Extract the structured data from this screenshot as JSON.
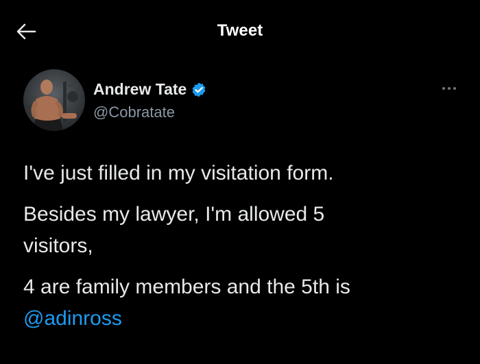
{
  "header": {
    "title": "Tweet",
    "back_icon": "arrow-left-icon"
  },
  "author": {
    "name": "Andrew Tate",
    "handle": "@Cobratate",
    "verified_icon": "verified-badge-icon",
    "verified_color": "#1d9bf0",
    "avatar": "avatar-photo"
  },
  "more_icon": "more-horizontal-icon",
  "tweet": {
    "line1": "I've just filled in my visitation form.",
    "line2a": "Besides my lawyer, I'm allowed 5",
    "line2b": "visitors,",
    "line3": "4 are family members and the 5th is",
    "mention": "@adinross"
  },
  "colors": {
    "background": "#000000",
    "text": "#e7e9ea",
    "secondary": "#8b98a5",
    "link": "#1d9bf0"
  }
}
